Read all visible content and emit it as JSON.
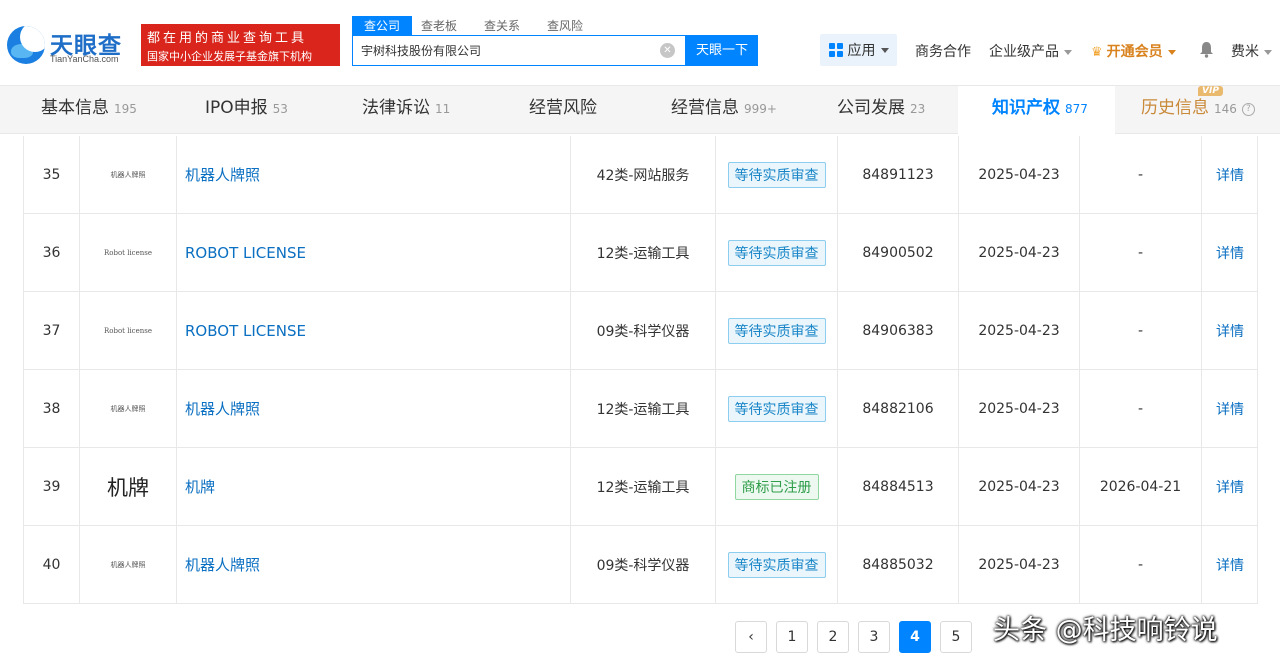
{
  "header": {
    "logo_name": "天眼查",
    "logo_domain": "TianYanCha.com",
    "slogan_line1": "都在用的商业查询工具",
    "slogan_line2": "国家中小企业发展子基金旗下机构",
    "search_tabs": [
      "查公司",
      "查老板",
      "查关系",
      "查风险"
    ],
    "search_value": "宇树科技股份有限公司",
    "search_button": "天眼一下",
    "apps_label": "应用",
    "business": "商务合作",
    "enterprise": "企业级产品",
    "vip": "开通会员",
    "user": "费米"
  },
  "subnav": {
    "tabs": [
      {
        "label": "基本信息",
        "count": "195"
      },
      {
        "label": "IPO申报",
        "count": "53"
      },
      {
        "label": "法律诉讼",
        "count": "11"
      },
      {
        "label": "经营风险",
        "count": ""
      },
      {
        "label": "经营信息",
        "count": "999+"
      },
      {
        "label": "公司发展",
        "count": "23"
      },
      {
        "label": "知识产权",
        "count": "877"
      },
      {
        "label": "历史信息",
        "count": "146"
      }
    ],
    "vip_badge": "VIP"
  },
  "table": {
    "rows": [
      {
        "no": "35",
        "image_text": "机器人牌照",
        "name": "机器人牌照",
        "category": "42类-网站服务",
        "status": "等待实质审查",
        "reg_no": "84891123",
        "date": "2025-04-23",
        "expiry": "-",
        "action": "详情"
      },
      {
        "no": "36",
        "image_text": "Robot license",
        "name": "ROBOT LICENSE",
        "category": "12类-运输工具",
        "status": "等待实质审查",
        "reg_no": "84900502",
        "date": "2025-04-23",
        "expiry": "-",
        "action": "详情"
      },
      {
        "no": "37",
        "image_text": "Robot license",
        "name": "ROBOT LICENSE",
        "category": "09类-科学仪器",
        "status": "等待实质审查",
        "reg_no": "84906383",
        "date": "2025-04-23",
        "expiry": "-",
        "action": "详情"
      },
      {
        "no": "38",
        "image_text": "机器人牌照",
        "name": "机器人牌照",
        "category": "12类-运输工具",
        "status": "等待实质审查",
        "reg_no": "84882106",
        "date": "2025-04-23",
        "expiry": "-",
        "action": "详情"
      },
      {
        "no": "39",
        "image_text": "机牌",
        "name": "机牌",
        "category": "12类-运输工具",
        "status": "商标已注册",
        "reg_no": "84884513",
        "date": "2025-04-23",
        "expiry": "2026-04-21",
        "action": "详情"
      },
      {
        "no": "40",
        "image_text": "机器人牌照",
        "name": "机器人牌照",
        "category": "09类-科学仪器",
        "status": "等待实质审查",
        "reg_no": "84885032",
        "date": "2025-04-23",
        "expiry": "-",
        "action": "详情"
      }
    ]
  },
  "pagination": {
    "prev": "‹",
    "pages": [
      "1",
      "2",
      "3",
      "4",
      "5"
    ],
    "current": "4"
  },
  "watermark": "头条 @科技响铃说",
  "colors": {
    "brand_blue": "#0084ff",
    "slogan_red": "#d9251b",
    "link_blue": "#0b6fc2",
    "vip_gold": "#d9831f"
  }
}
